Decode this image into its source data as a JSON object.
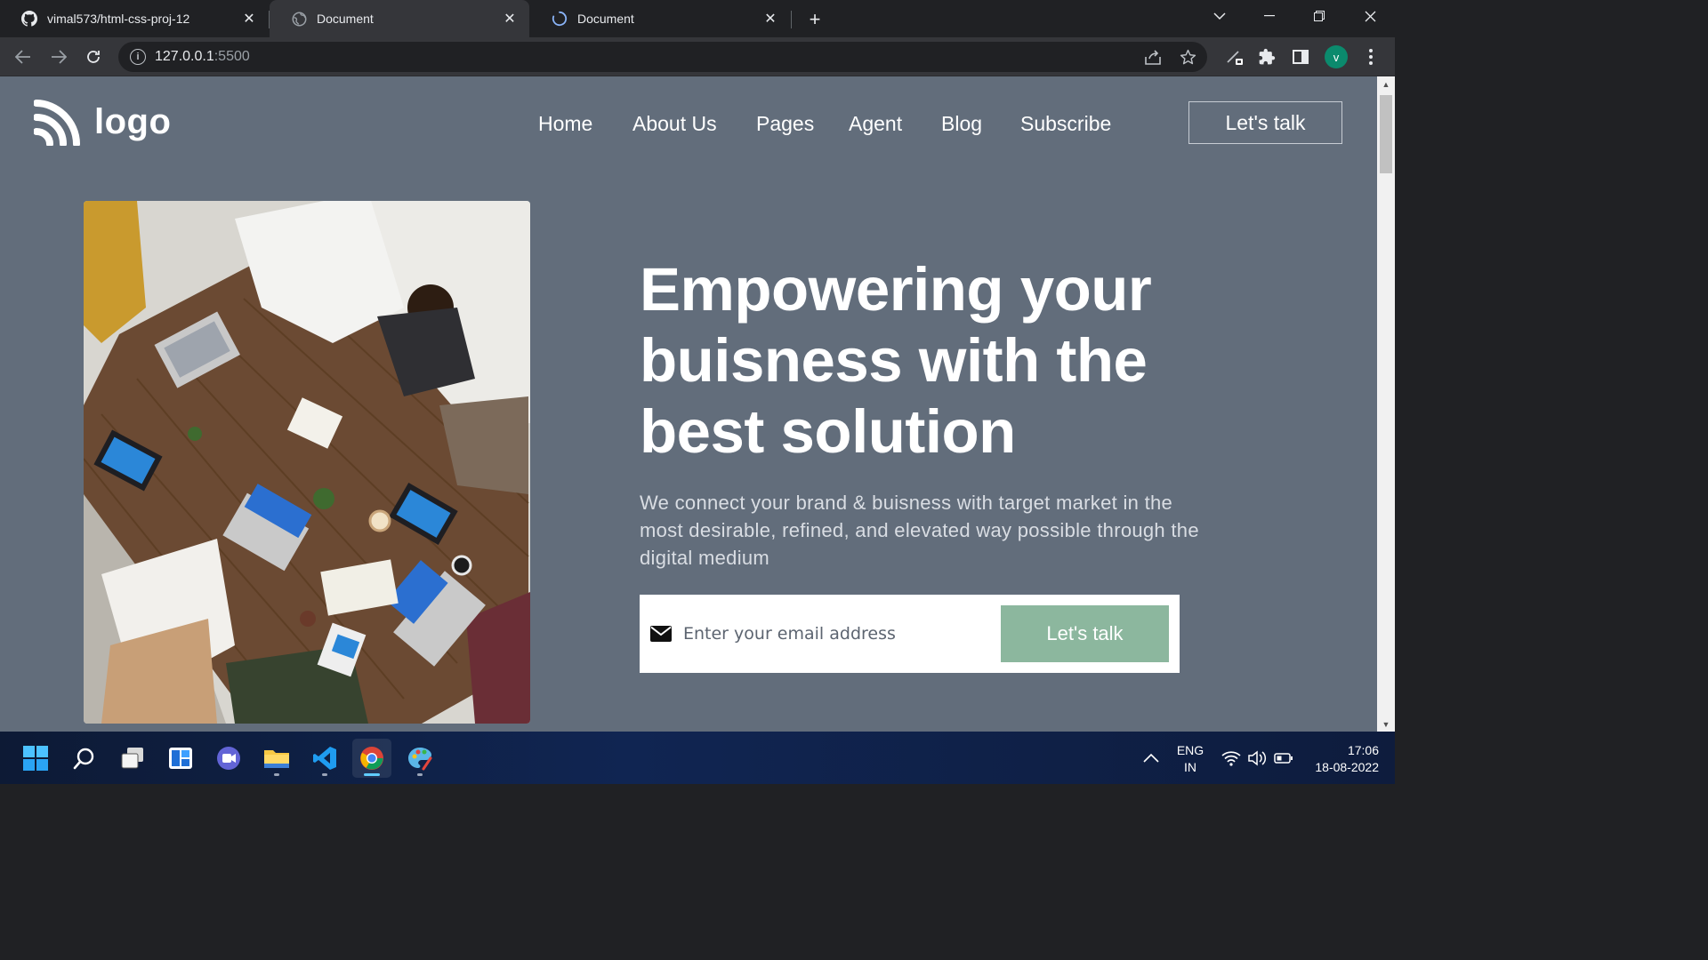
{
  "browser": {
    "tabs": [
      {
        "title": "vimal573/html-css-proj-12",
        "icon": "github-icon"
      },
      {
        "title": "Document",
        "icon": "globe-icon"
      },
      {
        "title": "Document",
        "icon": "loading-spinner-icon"
      }
    ],
    "url_host": "127.0.0.1",
    "url_port": ":5500",
    "profile_initial": "v"
  },
  "site": {
    "logo_text": "logo",
    "nav": [
      "Home",
      "About Us",
      "Pages",
      "Agent",
      "Blog",
      "Subscribe"
    ],
    "header_cta": "Let's talk",
    "hero_title": "Empowering your buisness with the best solution",
    "hero_subtitle": "We connect your brand & buisness with target market in the most desirable, refined, and elevated way possible through the digital medium",
    "email_placeholder": "Enter your email address",
    "signup_button": "Let's talk",
    "hero_image": "team-meeting-photo"
  },
  "taskbar": {
    "apps": [
      "windows-start-icon",
      "search-icon",
      "task-view-icon",
      "widgets-icon",
      "teams-chat-icon",
      "file-explorer-icon",
      "vscode-icon",
      "chrome-icon",
      "paint-icon"
    ],
    "lang_line1": "ENG",
    "lang_line2": "IN",
    "time": "17:06",
    "date": "18-08-2022"
  },
  "colors": {
    "page_bg": "#626d7b",
    "accent_button": "#8cb79e",
    "chrome_dark": "#202124",
    "chrome_toolbar": "#35363a"
  }
}
